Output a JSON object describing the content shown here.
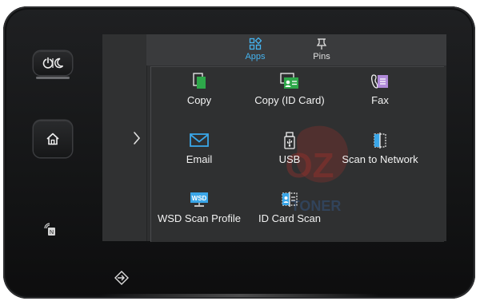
{
  "header": {
    "tabs": [
      {
        "label": "Apps",
        "selected": true,
        "icon": "apps-grid-icon"
      },
      {
        "label": "Pins",
        "selected": false,
        "icon": "pin-icon"
      }
    ]
  },
  "apps": [
    {
      "label": "Copy",
      "icon": "copy-icon"
    },
    {
      "label": "Copy (ID Card)",
      "icon": "copy-id-card-icon"
    },
    {
      "label": "Fax",
      "icon": "fax-icon"
    },
    {
      "label": "Email",
      "icon": "email-icon"
    },
    {
      "label": "USB",
      "icon": "usb-icon"
    },
    {
      "label": "Scan to Network",
      "icon": "scan-to-network-icon"
    },
    {
      "label": "WSD Scan Profile",
      "icon": "wsd-icon"
    },
    {
      "label": "ID Card Scan",
      "icon": "id-card-scan-icon"
    }
  ],
  "wsd_icon_text": "WSD",
  "watermark_text": "OZ TONER",
  "colors": {
    "accent": "#45b3ef",
    "app_green": "#2ea84a",
    "app_blue": "#3aa6e8",
    "fax_purple": "#b08ad8",
    "watermark_red": "#c8302a"
  }
}
